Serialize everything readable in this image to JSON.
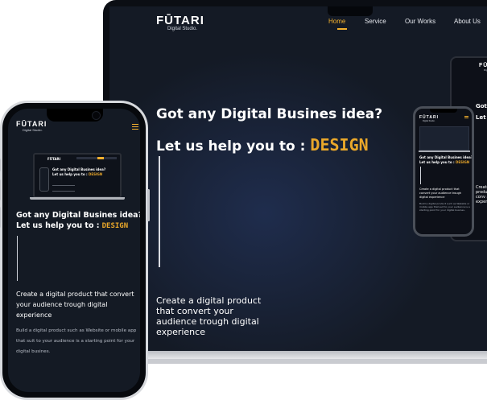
{
  "brand": {
    "name": "FŪTARI",
    "tagline": "Digital Studio."
  },
  "nav": {
    "items": [
      "Home",
      "Service",
      "Our Works",
      "About Us"
    ],
    "active": "Home"
  },
  "hero": {
    "headline": "Got any Digital Busines idea?",
    "prefix": "Let us help you to :",
    "accent_word": "DESIGN",
    "subheading": "Create a digital product that convert your audience trough digital experience",
    "body": "Build a digital product such as Website or mobile app that suit to your audience is a starting point for your digital busines."
  },
  "mini": {
    "headline_short": "Got a",
    "prefix_short": "Let u",
    "subheading_short": "Create a digital product that conv audienc experie"
  },
  "colors": {
    "accent": "#f2b02e",
    "background": "#141a25",
    "text": "#ffffff"
  },
  "icons": {
    "menu": "hamburger-menu-icon"
  }
}
